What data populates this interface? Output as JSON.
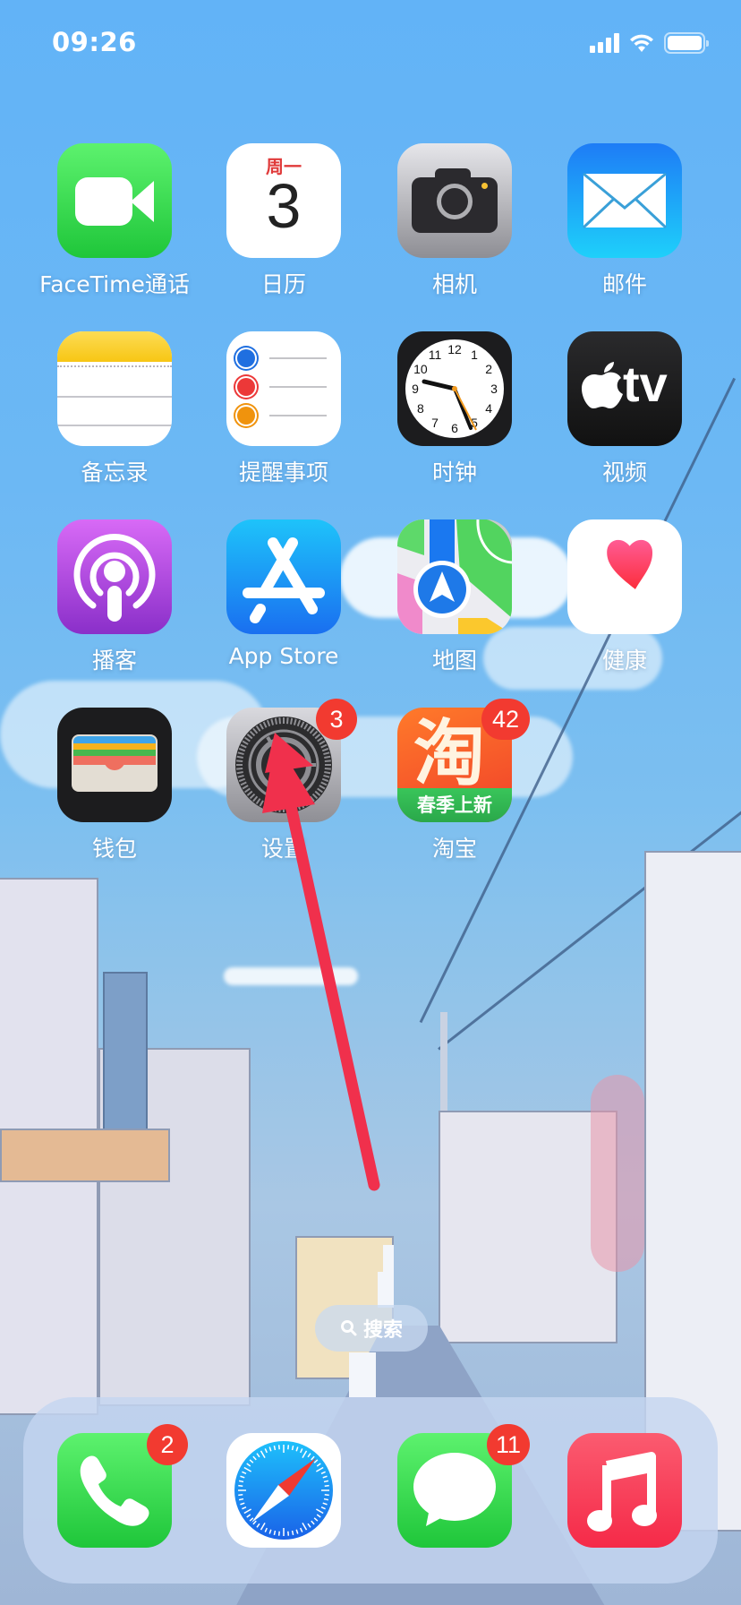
{
  "status_bar": {
    "time": "09:26",
    "icons": [
      "cellular-signal-icon",
      "wifi-icon",
      "battery-icon"
    ]
  },
  "home_screen": {
    "apps": [
      {
        "id": "facetime",
        "label": "FaceTime通话",
        "icon": "facetime-video-icon",
        "badge": null
      },
      {
        "id": "calendar",
        "label": "日历",
        "icon": "calendar-icon",
        "badge": null,
        "weekday": "周一",
        "day": "3"
      },
      {
        "id": "camera",
        "label": "相机",
        "icon": "camera-icon",
        "badge": null
      },
      {
        "id": "mail",
        "label": "邮件",
        "icon": "mail-envelope-icon",
        "badge": null
      },
      {
        "id": "notes",
        "label": "备忘录",
        "icon": "notes-icon",
        "badge": null
      },
      {
        "id": "reminders",
        "label": "提醒事项",
        "icon": "reminders-icon",
        "badge": null
      },
      {
        "id": "clock",
        "label": "时钟",
        "icon": "clock-icon",
        "badge": null
      },
      {
        "id": "tv",
        "label": "视频",
        "icon": "apple-tv-icon",
        "badge": null,
        "icon_text": "tv"
      },
      {
        "id": "podcasts",
        "label": "播客",
        "icon": "podcasts-icon",
        "badge": null
      },
      {
        "id": "appstore",
        "label": "App Store",
        "icon": "app-store-icon",
        "badge": null
      },
      {
        "id": "maps",
        "label": "地图",
        "icon": "maps-icon",
        "badge": null
      },
      {
        "id": "health",
        "label": "健康",
        "icon": "health-heart-icon",
        "badge": null
      },
      {
        "id": "wallet",
        "label": "钱包",
        "icon": "wallet-icon",
        "badge": null
      },
      {
        "id": "settings",
        "label": "设置",
        "icon": "settings-gear-icon",
        "badge": "3"
      },
      {
        "id": "taobao",
        "label": "淘宝",
        "icon": "taobao-icon",
        "badge": "42",
        "icon_char": "淘",
        "icon_banner": "春季上新"
      }
    ],
    "clock_numbers": [
      "12",
      "1",
      "2",
      "3",
      "4",
      "5",
      "6",
      "7",
      "8",
      "9",
      "10",
      "11"
    ]
  },
  "search": {
    "label": "搜索",
    "icon": "search-icon"
  },
  "dock": {
    "apps": [
      {
        "id": "phone",
        "icon": "phone-icon",
        "badge": "2"
      },
      {
        "id": "safari",
        "icon": "safari-compass-icon",
        "badge": null
      },
      {
        "id": "messages",
        "icon": "messages-icon",
        "badge": "11"
      },
      {
        "id": "music",
        "icon": "music-note-icon",
        "badge": null
      }
    ]
  },
  "annotation": {
    "type": "arrow",
    "color": "#f0304c",
    "points_to": "settings"
  },
  "colors": {
    "badge_red": "#f23a30",
    "facetime_green": "#34c759",
    "calendar_red": "#e03a3a"
  }
}
